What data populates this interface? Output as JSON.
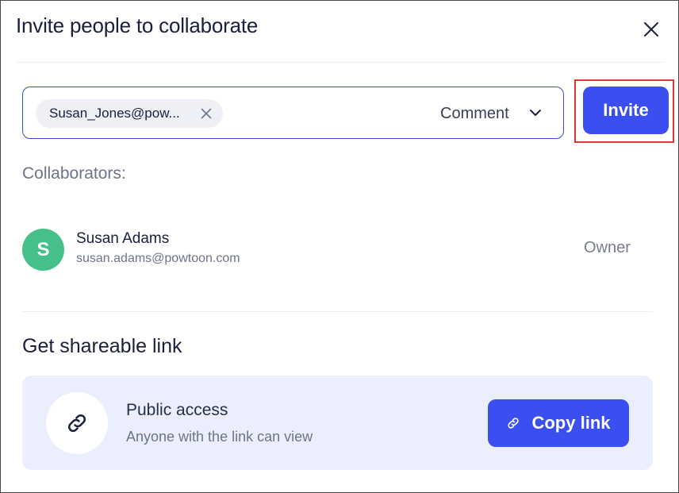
{
  "dialog": {
    "title": "Invite people to collaborate",
    "close_icon": "close-icon"
  },
  "invite": {
    "chip_email": "Susan_Jones@pow...",
    "chip_remove_icon": "close-icon",
    "role_selected": "Comment",
    "role_icon": "chevron-down-icon",
    "button_label": "Invite"
  },
  "collaborators": {
    "heading": "Collaborators:",
    "items": [
      {
        "initial": "S",
        "name": "Susan Adams",
        "email": "susan.adams@powtoon.com",
        "role": "Owner",
        "avatar_color": "#46c08a"
      }
    ]
  },
  "share_link": {
    "heading": "Get shareable link",
    "access_title": "Public access",
    "access_description": "Anyone with the link can view",
    "link_icon": "link-icon",
    "copy_label": "Copy link"
  },
  "colors": {
    "accent": "#3b4ff0",
    "highlight": "#e0343b",
    "card_bg": "#ebeefc"
  }
}
